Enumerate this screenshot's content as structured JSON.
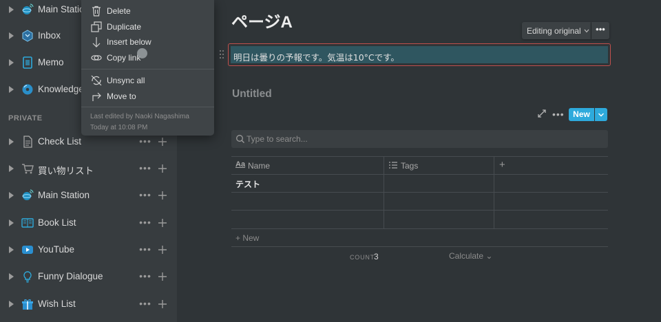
{
  "sidebar": {
    "top_items": [
      {
        "label": "Main Station",
        "icon": "globe-satellite-icon"
      },
      {
        "label": "Inbox",
        "icon": "inbox-icon"
      },
      {
        "label": "Memo",
        "icon": "memo-icon"
      },
      {
        "label": "Knowledge",
        "icon": "disc-icon"
      }
    ],
    "section_label": "PRIVATE",
    "private_items": [
      {
        "label": "Check List",
        "icon": "document-icon"
      },
      {
        "label": "買い物リスト",
        "icon": "shopping-cart-icon"
      },
      {
        "label": "Main Station",
        "icon": "globe-satellite-icon"
      },
      {
        "label": "Book List",
        "icon": "book-icon"
      },
      {
        "label": "YouTube",
        "icon": "youtube-icon"
      },
      {
        "label": "Funny Dialogue",
        "icon": "lightbulb-icon"
      },
      {
        "label": "Wish List",
        "icon": "gift-icon"
      }
    ],
    "more_glyph": "•••",
    "add_glyph": "+"
  },
  "context_menu": {
    "items": [
      {
        "label": "Delete",
        "icon": "trash-icon"
      },
      {
        "label": "Duplicate",
        "icon": "duplicate-icon"
      },
      {
        "label": "Insert below",
        "icon": "arrow-down-icon"
      },
      {
        "label": "Copy link",
        "icon": "link-icon"
      }
    ],
    "items2": [
      {
        "label": "Unsync all",
        "icon": "unsync-icon"
      },
      {
        "label": "Move to",
        "icon": "move-to-icon"
      }
    ],
    "last_edited": "Last edited by Naoki Nagashima",
    "timestamp": "Today at 10:08 PM"
  },
  "page": {
    "title": "ページA",
    "editing_label": "Editing original",
    "more_label": "•••",
    "synced_text": "明日は曇りの予報です。気温は10°Cです。"
  },
  "database": {
    "title": "Untitled",
    "new_label": "New",
    "search_placeholder": "Type to search...",
    "columns": [
      {
        "label": "Name",
        "icon": "text-aa-icon"
      },
      {
        "label": "Tags",
        "icon": "list-icon"
      }
    ],
    "add_column_label": "+",
    "rows": [
      {
        "name": "テスト",
        "tags": ""
      },
      {
        "name": "",
        "tags": ""
      },
      {
        "name": "",
        "tags": ""
      }
    ],
    "add_row_label": "+ New",
    "count_label": "COUNT",
    "count_value": "3",
    "calculate_label": "Calculate ⌄"
  },
  "colors": {
    "background": "#2f3437",
    "sidebar": "#373c3f",
    "accent": "#2eaadc",
    "synced_border": "#c0504d",
    "synced_fill": "#2f5660"
  }
}
